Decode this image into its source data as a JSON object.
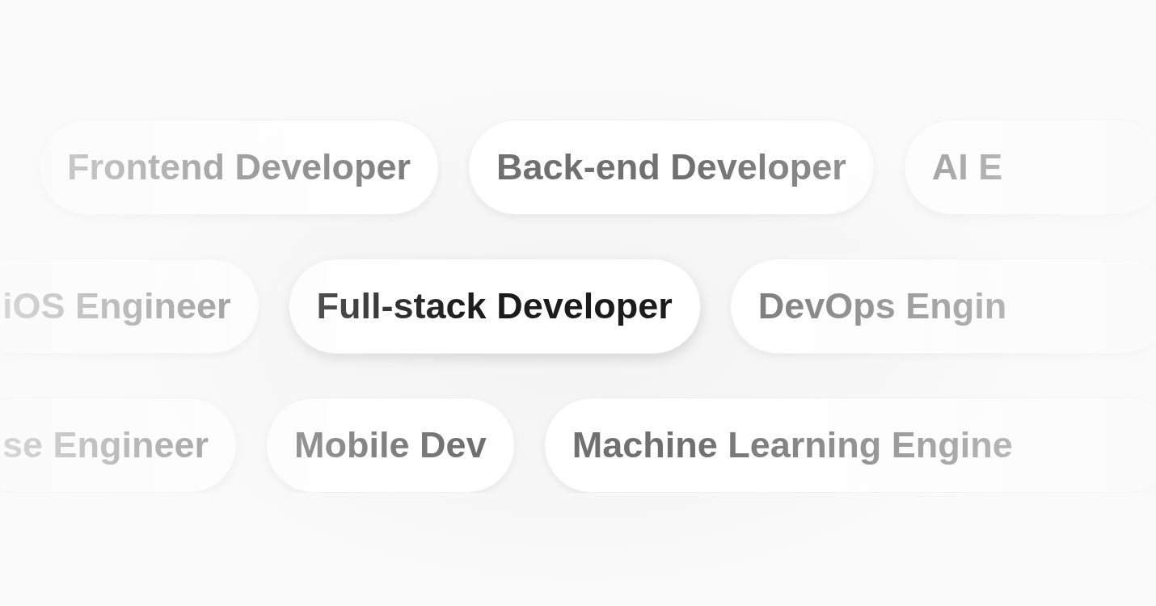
{
  "rows": [
    {
      "chips": [
        {
          "label": "Frontend Developer",
          "selected": false
        },
        {
          "label": "Back-end Developer",
          "selected": false
        },
        {
          "label": "AI E",
          "selected": false
        }
      ]
    },
    {
      "chips": [
        {
          "label": "iOS Engineer",
          "selected": false
        },
        {
          "label": "Full-stack Developer",
          "selected": true
        },
        {
          "label": "DevOps Engin",
          "selected": false
        }
      ]
    },
    {
      "chips": [
        {
          "label": "se Engineer",
          "selected": false
        },
        {
          "label": "Mobile Dev",
          "selected": false
        },
        {
          "label": "Machine Learning Engine",
          "selected": false
        }
      ]
    }
  ]
}
